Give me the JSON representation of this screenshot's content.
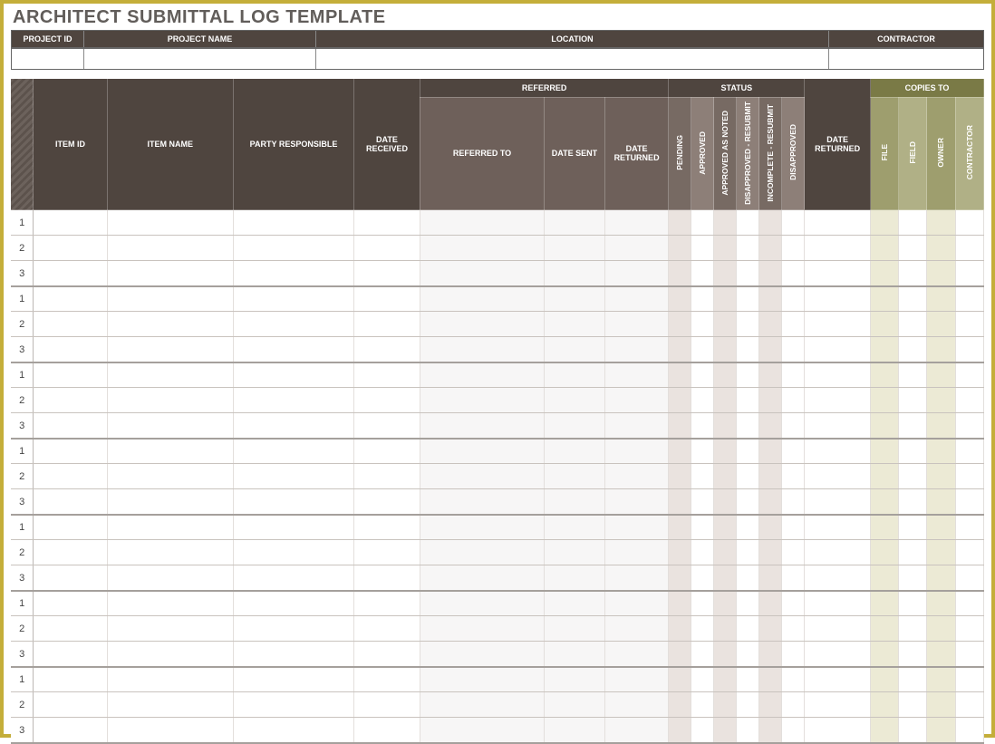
{
  "title": "ARCHITECT SUBMITTAL LOG TEMPLATE",
  "project_header": {
    "project_id": {
      "label": "PROJECT ID",
      "value": ""
    },
    "project_name": {
      "label": "PROJECT NAME",
      "value": ""
    },
    "location": {
      "label": "LOCATION",
      "value": ""
    },
    "contractor": {
      "label": "CONTRACTOR",
      "value": ""
    }
  },
  "columns": {
    "item_id": "ITEM ID",
    "item_name": "ITEM NAME",
    "party_responsible": "PARTY RESPONSIBLE",
    "date_received": "DATE RECEIVED",
    "referred_group": "REFERRED",
    "referred_to": "REFERRED TO",
    "date_sent": "DATE SENT",
    "date_returned_ref": "DATE RETURNED",
    "status_group": "STATUS",
    "status": {
      "pending": "PENDING",
      "approved": "APPROVED",
      "approved_as_noted": "APPROVED AS NOTED",
      "disapproved_resubmit": "DISAPPROVED - RESUBMIT",
      "incomplete_resubmit": "INCOMPLETE - RESUBMIT",
      "disapproved": "DISAPPROVED"
    },
    "date_returned": "DATE RETURNED",
    "copies_group": "COPIES TO",
    "copies": {
      "file": "FILE",
      "field": "FIELD",
      "owner": "OWNER",
      "contractor": "CONTRACTOR"
    }
  },
  "groups": [
    {
      "rows": [
        {
          "n": "1"
        },
        {
          "n": "2"
        },
        {
          "n": "3"
        }
      ]
    },
    {
      "rows": [
        {
          "n": "1"
        },
        {
          "n": "2"
        },
        {
          "n": "3"
        }
      ]
    },
    {
      "rows": [
        {
          "n": "1"
        },
        {
          "n": "2"
        },
        {
          "n": "3"
        }
      ]
    },
    {
      "rows": [
        {
          "n": "1"
        },
        {
          "n": "2"
        },
        {
          "n": "3"
        }
      ]
    },
    {
      "rows": [
        {
          "n": "1"
        },
        {
          "n": "2"
        },
        {
          "n": "3"
        }
      ]
    },
    {
      "rows": [
        {
          "n": "1"
        },
        {
          "n": "2"
        },
        {
          "n": "3"
        }
      ]
    },
    {
      "rows": [
        {
          "n": "1"
        },
        {
          "n": "2"
        },
        {
          "n": "3"
        }
      ]
    }
  ]
}
